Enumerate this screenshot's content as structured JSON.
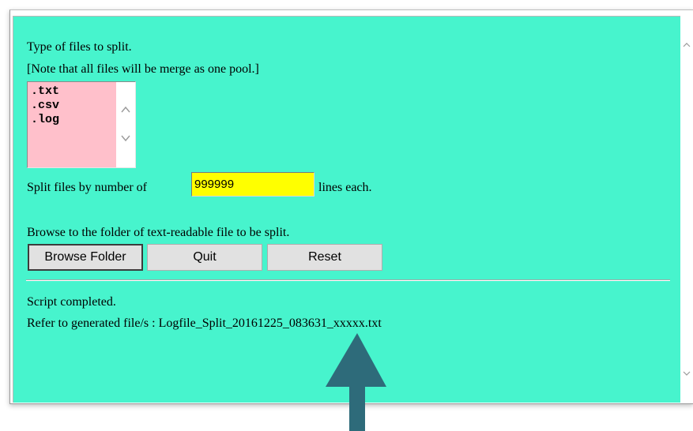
{
  "form": {
    "file_types_label": "Type of files to split.",
    "note_label": "[Note that all files will be merge as one pool.]",
    "file_types": [
      ".txt",
      ".csv",
      ".log"
    ],
    "split_prefix": "Split files by number of",
    "lines_value": "999999",
    "split_suffix": "lines each.",
    "browse_instruction": "Browse to the folder of text-readable file to be split."
  },
  "buttons": {
    "browse": "Browse Folder",
    "quit": "Quit",
    "reset": "Reset"
  },
  "status": {
    "line1": "Script completed.",
    "line2": "Refer to generated file/s : Logfile_Split_20161225_083631_xxxxx.txt"
  },
  "colors": {
    "panel_background": "#47f4cd",
    "listbox_background": "#ffc0cb",
    "input_background": "#ffff00",
    "annotation_arrow": "#2e6b7a"
  },
  "icons": {
    "scroll_up": "chevron-up-icon",
    "scroll_down": "chevron-down-icon",
    "annotation": "up-arrow-icon"
  }
}
